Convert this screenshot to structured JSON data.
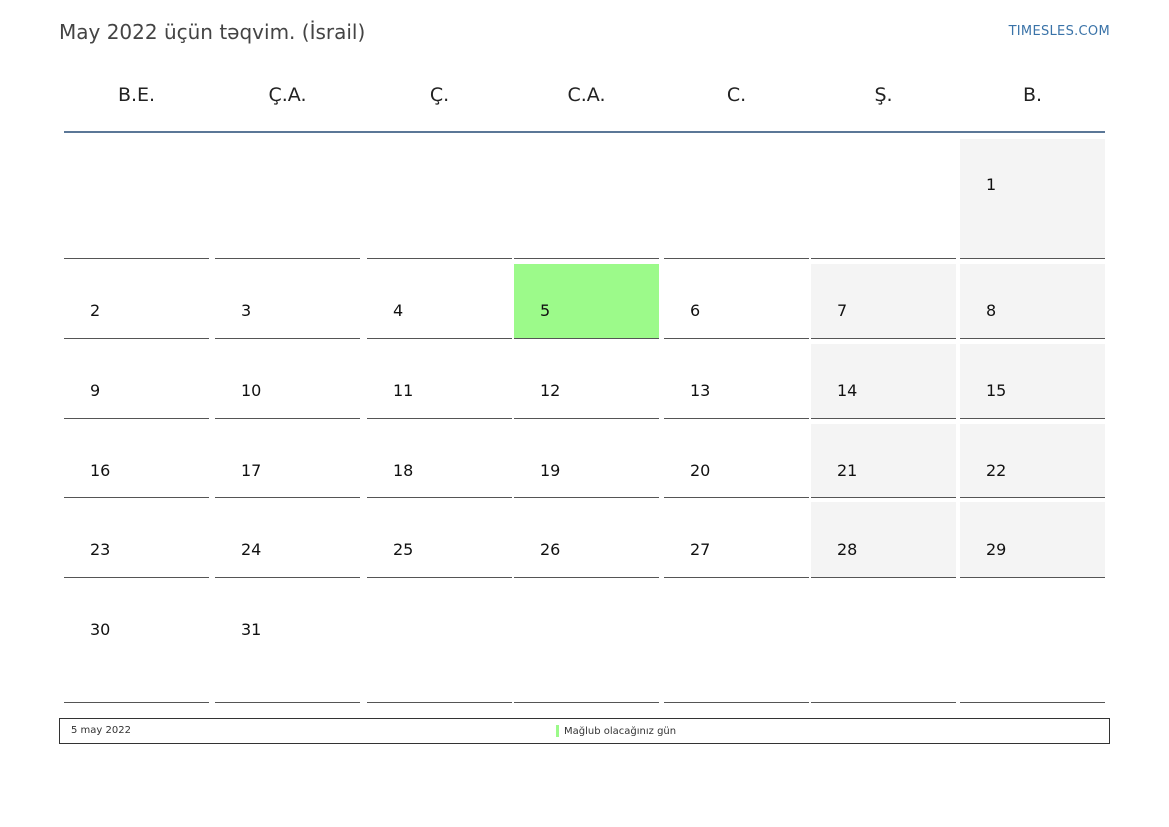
{
  "header": {
    "title": "May 2022 üçün təqvim. (İsrail)",
    "site": "TIMESLES.COM"
  },
  "weekdays": [
    "B.E.",
    "Ç.A.",
    "Ç.",
    "C.A.",
    "C.",
    "Ş.",
    "B."
  ],
  "weeks": [
    [
      "",
      "",
      "",
      "",
      "",
      "",
      "1"
    ],
    [
      "2",
      "3",
      "4",
      "5",
      "6",
      "7",
      "8"
    ],
    [
      "9",
      "10",
      "11",
      "12",
      "13",
      "14",
      "15"
    ],
    [
      "16",
      "17",
      "18",
      "19",
      "20",
      "21",
      "22"
    ],
    [
      "23",
      "24",
      "25",
      "26",
      "27",
      "28",
      "29"
    ],
    [
      "30",
      "31",
      "",
      "",
      "",
      "",
      ""
    ]
  ],
  "highlighted_day": "5",
  "weekend_columns": [
    5,
    6
  ],
  "legend": {
    "date": "5 may 2022",
    "label": "Mağlub olacağınız gün",
    "color": "#9cfa8a"
  },
  "colors": {
    "highlight": "#9cfa8a",
    "weekend": "#f4f4f4",
    "header_rule": "#5b7797",
    "link": "#3a73a8"
  }
}
